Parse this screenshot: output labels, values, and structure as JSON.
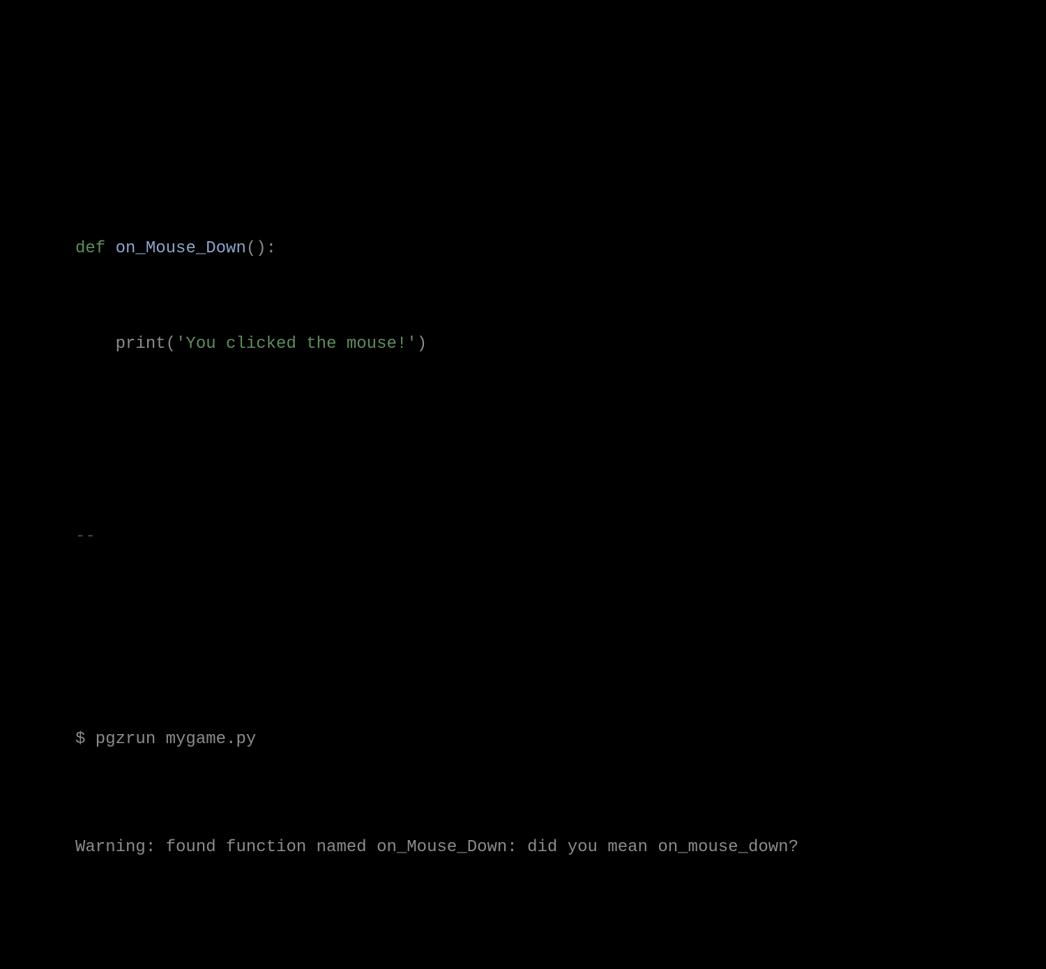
{
  "code": {
    "line1": {
      "keyword": "def",
      "space1": " ",
      "funcname": "on_Mouse_Down",
      "parens_colon": "():"
    },
    "line2": {
      "indent": "    ",
      "funccall": "print",
      "open_paren": "(",
      "string": "'You clicked the mouse!'",
      "close_paren": ")"
    }
  },
  "separator": "--",
  "terminal": {
    "command": "$ pgzrun mygame.py",
    "output": "Warning: found function named on_Mouse_Down: did you mean on_mouse_down?"
  }
}
